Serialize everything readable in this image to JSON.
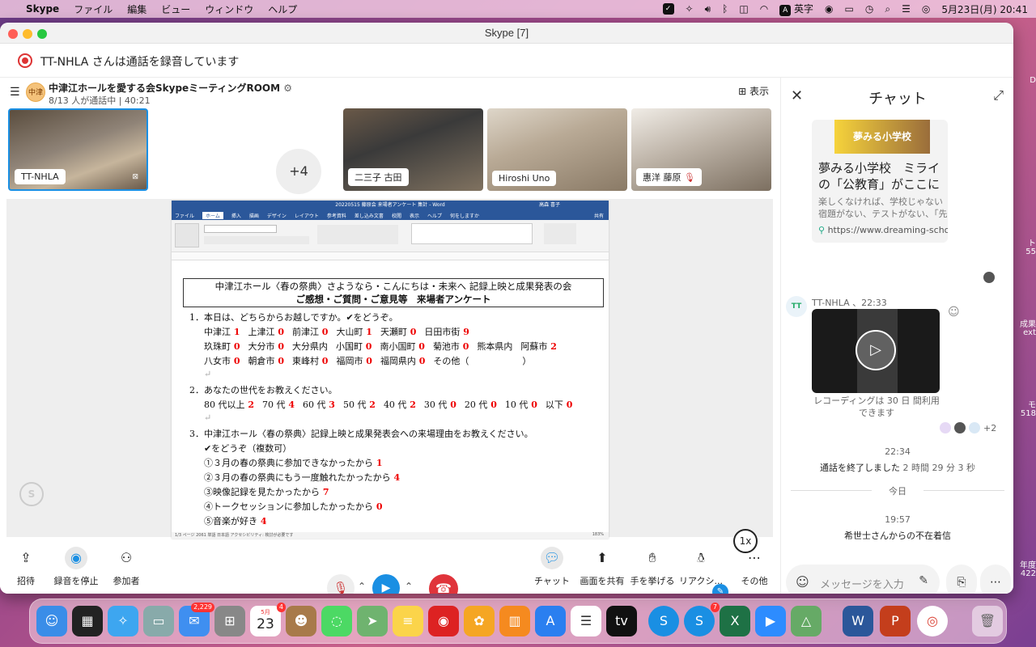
{
  "menubar": {
    "app": "Skype",
    "items": [
      "ファイル",
      "編集",
      "ビュー",
      "ウィンドウ",
      "ヘルプ"
    ],
    "input_mode": "英字",
    "datetime": "5月23日(月)  20:41"
  },
  "window": {
    "title": "Skype [7]"
  },
  "recording": {
    "text": "TT-NHLA さんは通話を録音しています"
  },
  "call_header": {
    "avatar_text": "中津",
    "title": "中津江ホールを愛する会SkypeミーティングROOM",
    "subtitle": "8/13 人が通話中 | 40:21",
    "view_label": "表示"
  },
  "participants": [
    {
      "name": "TT-NHLA"
    },
    {
      "name": "二三子 古田"
    },
    {
      "name": "Hiroshi Uno"
    },
    {
      "name": "惠洋 藤原"
    }
  ],
  "more_participants": "+4",
  "word": {
    "title": "20220515 藤原会 来場者アンケート 集計 - Word",
    "user": "高森 喜子",
    "tabs": [
      "ファイル",
      "ホーム",
      "挿入",
      "描画",
      "デザイン",
      "レイアウト",
      "参考資料",
      "差し込み文書",
      "校閲",
      "表示",
      "ヘルプ",
      "何をしますか"
    ],
    "share_label": "共有",
    "status": "1/3 ページ  2061 単語  日本語  アクセシビリティ: 検討が必要です",
    "zoom": "183%",
    "doc": {
      "heading1": "中津江ホール〈春の祭典〉さようなら・こんにちは・未来へ 記録上映と成果発表の会",
      "heading2": "ご感想・ご質問・ご意見等　来場者アンケート",
      "q1": "1．本日は、どちらからお越しですか。✔をどうぞ。",
      "q1_rows": [
        [
          [
            "中津江",
            "1"
          ],
          [
            "上津江",
            "0"
          ],
          [
            "前津江",
            "0"
          ],
          [
            "大山町",
            "1"
          ],
          [
            "天瀬町",
            "0"
          ],
          [
            "日田市街",
            "9"
          ]
        ],
        [
          [
            "玖珠町",
            "0"
          ],
          [
            "大分市",
            "0"
          ],
          [
            "大分県内",
            ""
          ],
          [
            "小国町",
            "0"
          ],
          [
            "南小国町",
            "0"
          ],
          [
            "菊池市",
            "0"
          ],
          [
            "熊本県内",
            ""
          ],
          [
            "阿蘇市",
            "2"
          ]
        ],
        [
          [
            "八女市",
            "0"
          ],
          [
            "朝倉市",
            "0"
          ],
          [
            "東峰村",
            "0"
          ],
          [
            "福岡市",
            "0"
          ],
          [
            "福岡県内",
            "0"
          ],
          [
            "その他（　　　　　　）",
            ""
          ]
        ]
      ],
      "q2": "2．あなたの世代をお教えください。",
      "q2_row": [
        [
          "80 代以上",
          "2"
        ],
        [
          "70 代",
          "4"
        ],
        [
          "60 代",
          "3"
        ],
        [
          "50 代",
          "2"
        ],
        [
          "40 代",
          "2"
        ],
        [
          "30 代",
          "0"
        ],
        [
          "20 代",
          "0"
        ],
        [
          "10 代",
          "0"
        ],
        [
          "以下",
          "0"
        ]
      ],
      "q3": "3．中津江ホール〈春の祭典〉記録上映と成果発表会への来場理由をお教えください。",
      "q3_note": "✔をどうぞ（複数可）",
      "q3_items": [
        [
          "①３月の春の祭典に参加できなかったから",
          "1"
        ],
        [
          "②３月の春の祭典にもう一度触れたかったから",
          "4"
        ],
        [
          "③映像記録を見たかったから",
          "7"
        ],
        [
          "④トークセッションに参加したかったから",
          "0"
        ],
        [
          "⑤音楽が好き",
          "4"
        ]
      ]
    }
  },
  "playback_speed": "1x",
  "controls": {
    "invite": "招待",
    "stop_recording": "録音を停止",
    "participants": "参加者",
    "chat": "チャット",
    "share_screen": "画面を共有",
    "raise_hand": "手を挙げる",
    "reactions": "リアクシ...",
    "more": "その他"
  },
  "chat": {
    "title": "チャット",
    "link_card": {
      "banner": "夢みる小学校",
      "title": "夢みる小学校　ミライの「公教育」がここに",
      "desc": "楽しくなければ、学校じゃない宿題がない、テストがない、「先",
      "url": "https://www.dreaming-scho..."
    },
    "message": {
      "avatar": "TT",
      "sender": "TT-NHLA 、22:33",
      "caption": "レコーディングは 30 日 間利用できます",
      "reactions_more": "+2"
    },
    "call_end": {
      "time": "22:34",
      "text": "通話を終了しました",
      "duration": "2 時間 29 分 3 秒"
    },
    "divider": "今日",
    "missed": {
      "time": "19:57",
      "text": "希世士さんからの不在着信"
    },
    "input_placeholder": "メッセージを入力"
  },
  "dock": {
    "mail_badge": "2,229",
    "calendar_month": "5月",
    "calendar_day": "23",
    "calendar_badge": "4",
    "skype_badge": "7"
  },
  "desktop_right": [
    "D",
    "ト",
    "55",
    "成果",
    "ext",
    "モ",
    "518",
    "年度",
    "422"
  ]
}
